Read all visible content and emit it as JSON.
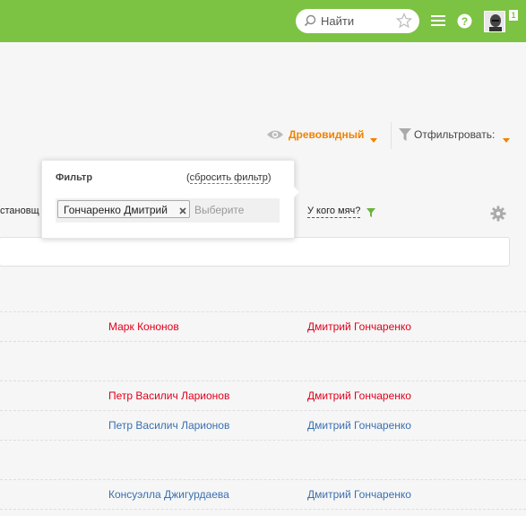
{
  "header": {
    "search": {
      "placeholder": "Найти"
    },
    "notifications_count": "1",
    "brand_color": "#7cc243"
  },
  "toolbar": {
    "view_mode_label": "Древовидный",
    "filter_label": "Отфильтровать:",
    "accent_color": "#f08200"
  },
  "table": {
    "columns": {
      "left_partial": "становщ",
      "ball": "У кого мяч?"
    },
    "rows": [
      {
        "setter": "Марк Кононов",
        "setter_color": "#e0001b",
        "ball": "Дмитрий Гончаренко"
      },
      {
        "setter": "Петр Василич Ларионов",
        "setter_color": "#e0001b",
        "ball": "Дмитрий Гончаренко"
      },
      {
        "setter": "Петр Василич Ларионов",
        "setter_color": "#3a6fb0",
        "ball": "Дмитрий Гончаренко"
      },
      {
        "setter": "Консуэлла Джигурдаева",
        "setter_color": "#3a6fb0",
        "ball": "Дмитрий Гончаренко"
      }
    ]
  },
  "filter_popup": {
    "title": "Фильтр",
    "reset_open": "(",
    "reset_label": "сбросить фильтр",
    "reset_close": ")",
    "selected_tag": "Гончаренко Дмитрий",
    "input_placeholder": "Выберите"
  }
}
